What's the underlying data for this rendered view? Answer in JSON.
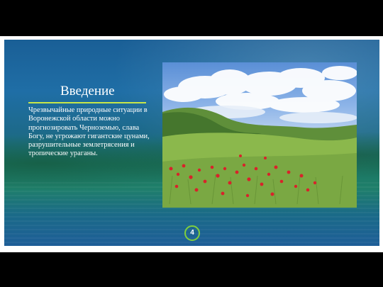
{
  "slide": {
    "title": "Введение",
    "body": "Чрезвычайные природные ситуации в Воронежской области можно прогнозировать Черноземью, слава Богу, не угрожают гигантские цунами, разрушительные землетрясения и тропические ураганы.",
    "page_number": "4"
  },
  "colors": {
    "accent_rule": "#c8e64a",
    "page_badge_border": "#7fcf3d",
    "text": "#ffffff",
    "outer_background": "#000000"
  }
}
